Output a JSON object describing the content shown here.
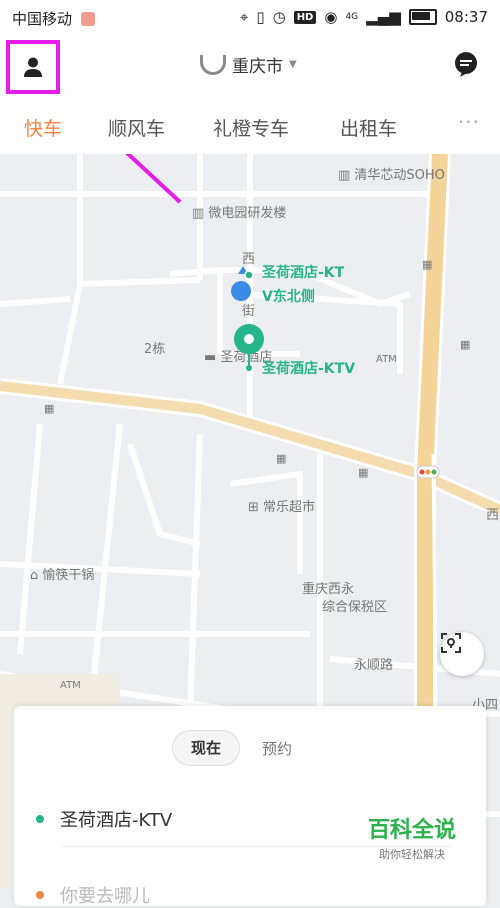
{
  "status_bar": {
    "carrier": "中国移动",
    "signal": "4G",
    "hd": "HD",
    "time": "08:37"
  },
  "header": {
    "city": "重庆市",
    "profile_icon": "person-icon",
    "message_icon": "chat-bubble-icon"
  },
  "tabs": [
    {
      "label": "快车",
      "active": true
    },
    {
      "label": "顺风车",
      "active": false
    },
    {
      "label": "礼橙专车",
      "active": false
    },
    {
      "label": "出租车",
      "active": false
    }
  ],
  "more_label": "···",
  "map": {
    "pois": {
      "tsinghua": "清华芯动SOHO",
      "weidian": "微电园研发楼",
      "building2": "2栋",
      "hotel": "圣荷酒店",
      "changle": "常乐超市",
      "yucuo": "愉筷干锅",
      "chongqing_west": "重庆西永",
      "bonded": "综合保税区",
      "yongshun": "永顺路",
      "atm1": "ATM",
      "atm2": "ATM",
      "xiaosi": "小四",
      "west_street": "西",
      "street_char": "街",
      "si": "西"
    },
    "pickup_label": [
      "圣荷酒店-KT",
      "V东北侧"
    ],
    "destination_pin_label": "圣荷酒店-KTV"
  },
  "card": {
    "toggle_now": "现在",
    "toggle_later": "预约",
    "origin": "圣荷酒店-KTV",
    "destination_placeholder": "你要去哪儿"
  },
  "watermark": {
    "title": "百科全说",
    "subtitle": "助你轻松解决"
  },
  "colors": {
    "accent": "#f28344",
    "green": "#26b48a",
    "highlight": "#e61ce8"
  }
}
